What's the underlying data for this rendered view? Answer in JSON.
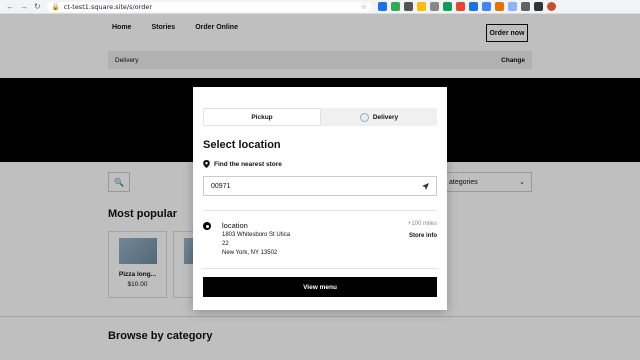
{
  "browser": {
    "url": "ct-test1.square.site/s/order"
  },
  "nav": {
    "items": [
      "Home",
      "Stories",
      "Order Online"
    ],
    "order_now": "Order now"
  },
  "delivery_bar": {
    "label": "Delivery",
    "change": "Change"
  },
  "filters": {
    "category_placeholder": "ategories"
  },
  "sections": {
    "most_popular": "Most popular",
    "browse": "Browse by category"
  },
  "products": [
    {
      "name": "Pizza long...",
      "price": "$10.00"
    },
    {
      "name": "",
      "price": "$"
    }
  ],
  "modal": {
    "tabs": [
      "Pickup",
      "Delivery"
    ],
    "title": "Select location",
    "nearest": "Find the nearest store",
    "zip": "00971",
    "location": {
      "name": "location",
      "address1": "1803 Whitesboro St Utica",
      "address2": "22",
      "address3": "New York, NY 13502",
      "distance": "+100 miles",
      "store_info": "Store info"
    },
    "view_menu": "View menu"
  }
}
